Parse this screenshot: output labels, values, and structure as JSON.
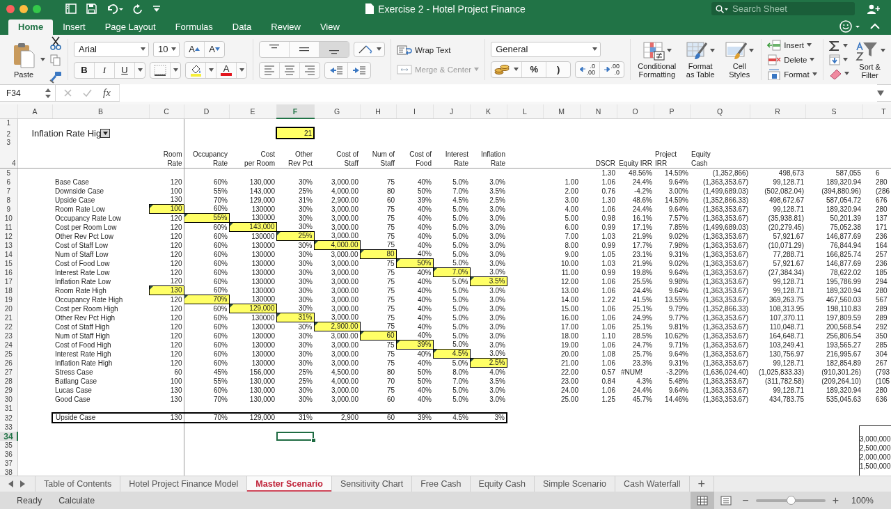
{
  "window": {
    "title": "Exercise 2 - Hotel Project Finance"
  },
  "search": {
    "placeholder": "Search Sheet"
  },
  "ribbon_tabs": [
    {
      "label": "Home",
      "selected": true
    },
    {
      "label": "Insert",
      "selected": false
    },
    {
      "label": "Page Layout",
      "selected": false
    },
    {
      "label": "Formulas",
      "selected": false
    },
    {
      "label": "Data",
      "selected": false
    },
    {
      "label": "Review",
      "selected": false
    },
    {
      "label": "View",
      "selected": false
    }
  ],
  "ribbon": {
    "paste": "Paste",
    "font": {
      "name": "Arial",
      "size": "10",
      "grow": "A",
      "shrink": "A",
      "bold": "B",
      "italic": "I",
      "underline": "U",
      "font_color": "A"
    },
    "vertical_align": [
      {
        "kind": "top",
        "selected": false
      },
      {
        "kind": "middle",
        "selected": false
      },
      {
        "kind": "bottom",
        "selected": true
      }
    ],
    "wrap_text": {
      "label": "Wrap Text"
    },
    "merge_center": {
      "label": "Merge & Center",
      "disabled": true
    },
    "number_format": "General",
    "number_buttons": [
      {
        "kind": "currency"
      },
      {
        "kind": "text",
        "label": "%"
      },
      {
        "kind": "text",
        "label": ")"
      },
      {
        "kind": "increase_decimal",
        "label": ".0\n.00"
      },
      {
        "kind": "decrease_decimal",
        "label": ".00\n.0"
      }
    ],
    "styles": [
      {
        "kind": "conditional",
        "label": "Conditional\nFormatting"
      },
      {
        "kind": "table",
        "label": "Format\nas Table"
      },
      {
        "kind": "cell",
        "label": "Cell\nStyles"
      }
    ],
    "cells": [
      {
        "kind": "insert",
        "label": "Insert"
      },
      {
        "kind": "delete",
        "label": "Delete"
      },
      {
        "kind": "format",
        "label": "Format"
      }
    ],
    "sort_filter": "Sort &\nFilter"
  },
  "formula_bar": {
    "name_box": "F34",
    "fx": "fx"
  },
  "sheet": {
    "columns": [
      {
        "label": "A",
        "selected": false
      },
      {
        "label": "B",
        "selected": false
      },
      {
        "label": "C",
        "selected": false
      },
      {
        "label": "D",
        "selected": false
      },
      {
        "label": "E",
        "selected": false
      },
      {
        "label": "F",
        "selected": true
      },
      {
        "label": "G",
        "selected": false
      },
      {
        "label": "H",
        "selected": false
      },
      {
        "label": "I",
        "selected": false
      },
      {
        "label": "J",
        "selected": false
      },
      {
        "label": "K",
        "selected": false
      },
      {
        "label": "L",
        "selected": false
      },
      {
        "label": "M",
        "selected": false
      },
      {
        "label": "N",
        "selected": false
      },
      {
        "label": "O",
        "selected": false
      },
      {
        "label": "P",
        "selected": false
      },
      {
        "label": "Q",
        "selected": false
      },
      {
        "label": "R",
        "selected": false
      },
      {
        "label": "S",
        "selected": false
      },
      {
        "label": "T",
        "selected": false
      }
    ],
    "row_headers": [
      {
        "label": "1",
        "selected": false
      },
      {
        "label": "2",
        "selected": false
      },
      {
        "label": "3",
        "selected": false
      },
      {
        "label": "4",
        "selected": false
      },
      {
        "label": "5",
        "selected": false
      },
      {
        "label": "6",
        "selected": false
      },
      {
        "label": "7",
        "selected": false
      },
      {
        "label": "8",
        "selected": false
      },
      {
        "label": "9",
        "selected": false
      },
      {
        "label": "10",
        "selected": false
      },
      {
        "label": "11",
        "selected": false
      },
      {
        "label": "12",
        "selected": false
      },
      {
        "label": "13",
        "selected": false
      },
      {
        "label": "14",
        "selected": false
      },
      {
        "label": "15",
        "selected": false
      },
      {
        "label": "16",
        "selected": false
      },
      {
        "label": "17",
        "selected": false
      },
      {
        "label": "18",
        "selected": false
      },
      {
        "label": "19",
        "selected": false
      },
      {
        "label": "20",
        "selected": false
      },
      {
        "label": "21",
        "selected": false
      },
      {
        "label": "22",
        "selected": false
      },
      {
        "label": "23",
        "selected": false
      },
      {
        "label": "24",
        "selected": false
      },
      {
        "label": "25",
        "selected": false
      },
      {
        "label": "26",
        "selected": false
      },
      {
        "label": "27",
        "selected": false
      },
      {
        "label": "28",
        "selected": false
      },
      {
        "label": "29",
        "selected": false
      },
      {
        "label": "30",
        "selected": false
      },
      {
        "label": "31",
        "selected": false
      },
      {
        "label": "32",
        "selected": false
      },
      {
        "label": "33",
        "selected": false
      },
      {
        "label": "34",
        "selected": true
      },
      {
        "label": "35",
        "selected": false
      },
      {
        "label": "36",
        "selected": false
      },
      {
        "label": "37",
        "selected": false
      },
      {
        "label": "38",
        "selected": false
      }
    ],
    "selector": "Inflation Rate Hig",
    "counter": "21",
    "input_headers": [
      "Room\nRate",
      "Occupancy\nRate",
      "Cost\nper Room",
      "Other\nRev Pct",
      "Cost of\nStaff",
      "Num of\nStaff",
      "Cost of\nFood",
      "Interest\nRate",
      "Inflation\nRate"
    ],
    "output_headers": [
      "DSCR",
      "Equity IRR",
      "Project\nIRR",
      "Equity\nCash"
    ],
    "summary_row": [
      "1.30",
      "48.56%",
      "14.59%",
      "(1,352,866)",
      "498,673",
      "587,055",
      "6"
    ],
    "scenarios": [
      {
        "label": "Base Case",
        "inputs": [
          "120",
          "60%",
          "130,000",
          "30%",
          "3,000.00",
          "75",
          "40%",
          "5.0%",
          "3.0%"
        ],
        "results": [
          "1.00",
          "1.06",
          "24.4%",
          "9.64%",
          "(1,363,353.67)",
          "99,128.71",
          "189,320.94",
          "280"
        ]
      },
      {
        "label": "Downside Case",
        "inputs": [
          "100",
          "55%",
          "143,000",
          "25%",
          "4,000.00",
          "80",
          "50%",
          "7.0%",
          "3.5%"
        ],
        "results": [
          "2.00",
          "0.76",
          "-4.2%",
          "3.00%",
          "(1,499,689.03)",
          "(502,082.04)",
          "(394,880.96)",
          "(286"
        ]
      },
      {
        "label": "Upside Case",
        "inputs": [
          "130",
          "70%",
          "129,000",
          "31%",
          "2,900.00",
          "60",
          "39%",
          "4.5%",
          "2.5%"
        ],
        "results": [
          "3.00",
          "1.30",
          "48.6%",
          "14.59%",
          "(1,352,866.33)",
          "498,672.67",
          "587,054.72",
          "676"
        ]
      },
      {
        "label": "Room Rate Low",
        "highlighted": [
          true,
          false,
          false,
          false,
          false,
          false,
          false,
          false,
          false
        ],
        "inputs": [
          "100",
          "60%",
          "130000",
          "30%",
          "3,000.00",
          "75",
          "40%",
          "5.0%",
          "3.0%"
        ],
        "results": [
          "4.00",
          "1.06",
          "24.4%",
          "9.64%",
          "(1,363,353.67)",
          "99,128.71",
          "189,320.94",
          "280"
        ]
      },
      {
        "label": "Occupancy Rate Low",
        "highlighted": [
          false,
          true,
          false,
          false,
          false,
          false,
          false,
          false,
          false
        ],
        "inputs": [
          "120",
          "55%",
          "130000",
          "30%",
          "3,000.00",
          "75",
          "40%",
          "5.0%",
          "3.0%"
        ],
        "results": [
          "5.00",
          "0.98",
          "16.1%",
          "7.57%",
          "(1,363,353.67)",
          "(35,938.81)",
          "50,201.39",
          "137"
        ]
      },
      {
        "label": "Cost per Room Low",
        "highlighted": [
          false,
          false,
          true,
          false,
          false,
          false,
          false,
          false,
          false
        ],
        "inputs": [
          "120",
          "60%",
          "143,000",
          "30%",
          "3,000.00",
          "75",
          "40%",
          "5.0%",
          "3.0%"
        ],
        "results": [
          "6.00",
          "0.99",
          "17.1%",
          "7.85%",
          "(1,499,689.03)",
          "(20,279.45)",
          "75,052.38",
          "171"
        ]
      },
      {
        "label": "Other Rev Pct Low",
        "highlighted": [
          false,
          false,
          false,
          true,
          false,
          false,
          false,
          false,
          false
        ],
        "inputs": [
          "120",
          "60%",
          "130000",
          "25%",
          "3,000.00",
          "75",
          "40%",
          "5.0%",
          "3.0%"
        ],
        "results": [
          "7.00",
          "1.03",
          "21.9%",
          "9.02%",
          "(1,363,353.67)",
          "57,921.67",
          "146,877.69",
          "236"
        ]
      },
      {
        "label": "Cost of Staff Low",
        "highlighted": [
          false,
          false,
          false,
          false,
          true,
          false,
          false,
          false,
          false
        ],
        "inputs": [
          "120",
          "60%",
          "130000",
          "30%",
          "4,000.00",
          "75",
          "40%",
          "5.0%",
          "3.0%"
        ],
        "results": [
          "8.00",
          "0.99",
          "17.7%",
          "7.98%",
          "(1,363,353.67)",
          "(10,071.29)",
          "76,844.94",
          "164"
        ]
      },
      {
        "label": "Num of Staff Low",
        "highlighted": [
          false,
          false,
          false,
          false,
          false,
          true,
          false,
          false,
          false
        ],
        "inputs": [
          "120",
          "60%",
          "130000",
          "30%",
          "3,000.00",
          "80",
          "40%",
          "5.0%",
          "3.0%"
        ],
        "results": [
          "9.00",
          "1.05",
          "23.1%",
          "9.31%",
          "(1,363,353.67)",
          "77,288.71",
          "166,825.74",
          "257"
        ]
      },
      {
        "label": "Cost of Food Low",
        "highlighted": [
          false,
          false,
          false,
          false,
          false,
          false,
          true,
          false,
          false
        ],
        "inputs": [
          "120",
          "60%",
          "130000",
          "30%",
          "3,000.00",
          "75",
          "50%",
          "5.0%",
          "3.0%"
        ],
        "results": [
          "10.00",
          "1.03",
          "21.9%",
          "9.02%",
          "(1,363,353.67)",
          "57,921.67",
          "146,877.69",
          "236"
        ]
      },
      {
        "label": "Interest Rate Low",
        "highlighted": [
          false,
          false,
          false,
          false,
          false,
          false,
          false,
          true,
          false
        ],
        "inputs": [
          "120",
          "60%",
          "130000",
          "30%",
          "3,000.00",
          "75",
          "40%",
          "7.0%",
          "3.0%"
        ],
        "results": [
          "11.00",
          "0.99",
          "19.8%",
          "9.64%",
          "(1,363,353.67)",
          "(27,384.34)",
          "78,622.02",
          "185"
        ]
      },
      {
        "label": "Inflation Rate Low",
        "highlighted": [
          false,
          false,
          false,
          false,
          false,
          false,
          false,
          false,
          true
        ],
        "inputs": [
          "120",
          "60%",
          "130000",
          "30%",
          "3,000.00",
          "75",
          "40%",
          "5.0%",
          "3.5%"
        ],
        "results": [
          "12.00",
          "1.06",
          "25.5%",
          "9.98%",
          "(1,363,353.67)",
          "99,128.71",
          "195,786.99",
          "294"
        ]
      },
      {
        "label": "Room Rate High",
        "highlighted": [
          true,
          false,
          false,
          false,
          false,
          false,
          false,
          false,
          false
        ],
        "inputs": [
          "130",
          "60%",
          "130000",
          "30%",
          "3,000.00",
          "75",
          "40%",
          "5.0%",
          "3.0%"
        ],
        "results": [
          "13.00",
          "1.06",
          "24.4%",
          "9.64%",
          "(1,363,353.67)",
          "99,128.71",
          "189,320.94",
          "280"
        ]
      },
      {
        "label": "Occupancy Rate High",
        "highlighted": [
          false,
          true,
          false,
          false,
          false,
          false,
          false,
          false,
          false
        ],
        "inputs": [
          "120",
          "70%",
          "130000",
          "30%",
          "3,000.00",
          "75",
          "40%",
          "5.0%",
          "3.0%"
        ],
        "results": [
          "14.00",
          "1.22",
          "41.5%",
          "13.55%",
          "(1,363,353.67)",
          "369,263.75",
          "467,560.03",
          "567"
        ]
      },
      {
        "label": "Cost per Room High",
        "highlighted": [
          false,
          false,
          true,
          false,
          false,
          false,
          false,
          false,
          false
        ],
        "inputs": [
          "120",
          "60%",
          "129,000",
          "30%",
          "3,000.00",
          "75",
          "40%",
          "5.0%",
          "3.0%"
        ],
        "results": [
          "15.00",
          "1.06",
          "25.1%",
          "9.79%",
          "(1,352,866.33)",
          "108,313.95",
          "198,110.83",
          "289"
        ]
      },
      {
        "label": "Other Rev Pct High",
        "highlighted": [
          false,
          false,
          false,
          true,
          false,
          false,
          false,
          false,
          false
        ],
        "inputs": [
          "120",
          "60%",
          "130000",
          "31%",
          "3,000.00",
          "75",
          "40%",
          "5.0%",
          "3.0%"
        ],
        "results": [
          "16.00",
          "1.06",
          "24.9%",
          "9.77%",
          "(1,363,353.67)",
          "107,370.11",
          "197,809.59",
          "289"
        ]
      },
      {
        "label": "Cost of Staff High",
        "highlighted": [
          false,
          false,
          false,
          false,
          true,
          false,
          false,
          false,
          false
        ],
        "inputs": [
          "120",
          "60%",
          "130000",
          "30%",
          "2,900.00",
          "75",
          "40%",
          "5.0%",
          "3.0%"
        ],
        "results": [
          "17.00",
          "1.06",
          "25.1%",
          "9.81%",
          "(1,363,353.67)",
          "110,048.71",
          "200,568.54",
          "292"
        ]
      },
      {
        "label": "Num of Staff High",
        "highlighted": [
          false,
          false,
          false,
          false,
          false,
          true,
          false,
          false,
          false
        ],
        "inputs": [
          "120",
          "60%",
          "130000",
          "30%",
          "3,000.00",
          "60",
          "40%",
          "5.0%",
          "3.0%"
        ],
        "results": [
          "18.00",
          "1.10",
          "28.5%",
          "10.62%",
          "(1,363,353.67)",
          "164,648.71",
          "256,806.54",
          "350"
        ]
      },
      {
        "label": "Cost of Food High",
        "highlighted": [
          false,
          false,
          false,
          false,
          false,
          false,
          true,
          false,
          false
        ],
        "inputs": [
          "120",
          "60%",
          "130000",
          "30%",
          "3,000.00",
          "75",
          "39%",
          "5.0%",
          "3.0%"
        ],
        "results": [
          "19.00",
          "1.06",
          "24.7%",
          "9.71%",
          "(1,363,353.67)",
          "103,249.41",
          "193,565.27",
          "285"
        ]
      },
      {
        "label": "Interest Rate High",
        "highlighted": [
          false,
          false,
          false,
          false,
          false,
          false,
          false,
          true,
          false
        ],
        "inputs": [
          "120",
          "60%",
          "130000",
          "30%",
          "3,000.00",
          "75",
          "40%",
          "4.5%",
          "3.0%"
        ],
        "results": [
          "20.00",
          "1.08",
          "25.7%",
          "9.64%",
          "(1,363,353.67)",
          "130,756.97",
          "216,995.67",
          "304"
        ]
      },
      {
        "label": "Inflation Rate High",
        "highlighted": [
          false,
          false,
          false,
          false,
          false,
          false,
          false,
          false,
          true
        ],
        "inputs": [
          "120",
          "60%",
          "130000",
          "30%",
          "3,000.00",
          "75",
          "40%",
          "5.0%",
          "2.5%"
        ],
        "results": [
          "21.00",
          "1.06",
          "23.3%",
          "9.31%",
          "(1,363,353.67)",
          "99,128.71",
          "182,854.89",
          "267"
        ]
      },
      {
        "label": "Stress Case",
        "inputs": [
          "60",
          "45%",
          "156,000",
          "25%",
          "4,500.00",
          "80",
          "50%",
          "8.0%",
          "4.0%"
        ],
        "results": [
          "22.00",
          "0.57",
          "#NUM!",
          "-3.29%",
          "(1,636,024.40)",
          "(1,025,833.33)",
          "(910,301.26)",
          "(793"
        ]
      },
      {
        "label": "Batlang Case",
        "inputs": [
          "100",
          "55%",
          "130,000",
          "25%",
          "4,000.00",
          "70",
          "50%",
          "7.0%",
          "3.5%"
        ],
        "results": [
          "23.00",
          "0.84",
          "4.3%",
          "5.48%",
          "(1,363,353.67)",
          "(311,782.58)",
          "(209,264.10)",
          "(105"
        ]
      },
      {
        "label": "Lucas Case",
        "inputs": [
          "130",
          "60%",
          "130,000",
          "30%",
          "3,000.00",
          "75",
          "40%",
          "5.0%",
          "3.0%"
        ],
        "results": [
          "24.00",
          "1.06",
          "24.4%",
          "9.64%",
          "(1,363,353.67)",
          "99,128.71",
          "189,320.94",
          "280"
        ]
      },
      {
        "label": "Good Case",
        "inputs": [
          "130",
          "70%",
          "130,000",
          "30%",
          "3,000.00",
          "60",
          "40%",
          "5.0%",
          "3.0%"
        ],
        "results": [
          "25.00",
          "1.25",
          "45.7%",
          "14.46%",
          "(1,363,353.67)",
          "434,783.75",
          "535,045.63",
          "636"
        ]
      }
    ],
    "current": {
      "label": "Upside Case",
      "inputs": [
        "130",
        "70%",
        "129,000",
        "31%",
        "2,900",
        "60",
        "39%",
        "4.5%",
        "3%"
      ]
    },
    "chart_axis_labels": [
      "3,000,000",
      "2,500,000",
      "2,000,000",
      "1,500,000"
    ]
  },
  "sheet_tabs": [
    {
      "label": "Table of Contents",
      "selected": false
    },
    {
      "label": "Hotel Project Finance Model",
      "selected": false
    },
    {
      "label": "Master Scenario",
      "selected": true
    },
    {
      "label": "Sensitivity Chart",
      "selected": false
    },
    {
      "label": "Free Cash",
      "selected": false
    },
    {
      "label": "Equity Cash",
      "selected": false
    },
    {
      "label": "Simple Scenario",
      "selected": false
    },
    {
      "label": "Cash Waterfall",
      "selected": false
    }
  ],
  "add_sheet": "+",
  "status_bar": {
    "mode": "Ready",
    "action": "Calculate",
    "views": [
      {
        "kind": "normal",
        "selected": true
      },
      {
        "kind": "page_layout",
        "selected": false
      }
    ],
    "zoom": {
      "minus": "−",
      "plus": "+",
      "level": 0.5,
      "reading": "100%"
    }
  }
}
